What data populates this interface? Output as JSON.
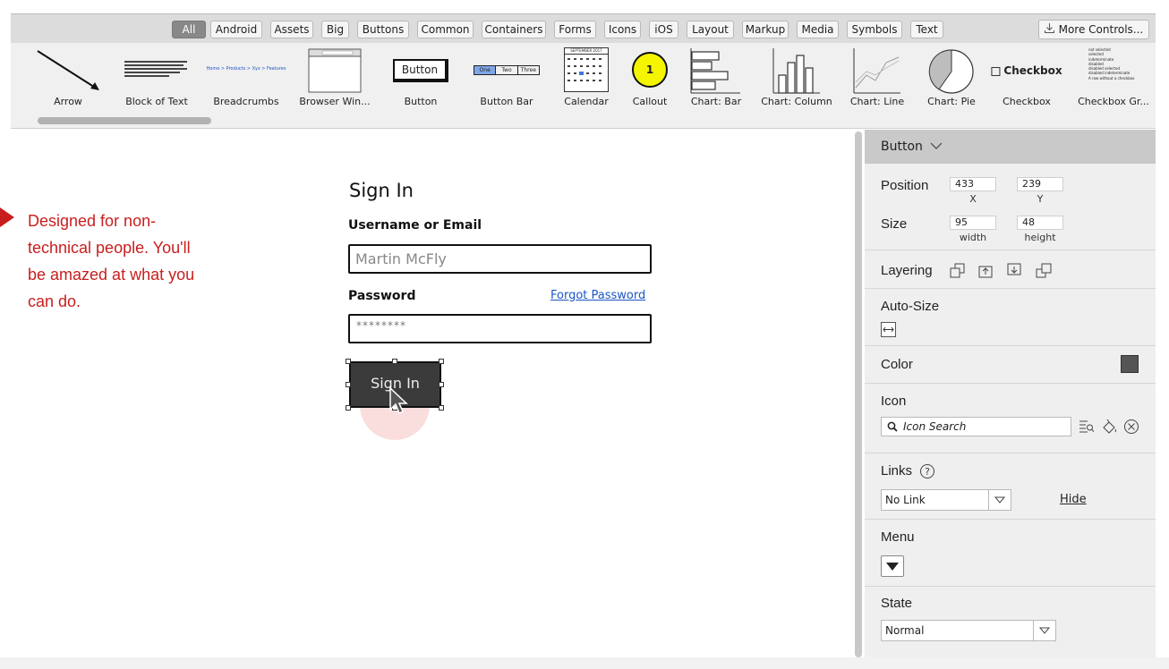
{
  "toolbar": {
    "tabs": [
      "All",
      "Android",
      "Assets",
      "Big",
      "Buttons",
      "Common",
      "Containers",
      "Forms",
      "Icons",
      "iOS",
      "Layout",
      "Markup",
      "Media",
      "Symbols",
      "Text"
    ],
    "active_tab": "All",
    "more_controls": "More Controls..."
  },
  "palette": {
    "items": [
      "Arrow",
      "Block of Text",
      "Breadcrumbs",
      "Browser Win...",
      "Button",
      "Button Bar",
      "Calendar",
      "Callout",
      "Chart: Bar",
      "Chart: Column",
      "Chart: Line",
      "Chart: Pie",
      "Checkbox",
      "Checkbox Gr..."
    ],
    "thumb_texts": {
      "breadcrumbs": "Home > Products > Xyz > Features",
      "button": "Button",
      "button_bar": [
        "One",
        "Two",
        "Three"
      ],
      "calendar_month": "SEPTEMBER 2017",
      "callout_number": "1",
      "checkbox": "Checkbox",
      "checkbox_group": [
        "not selected",
        "selected",
        "indeterminate",
        "disabled",
        "disabled selected",
        "disabled indeterminate",
        "A row without a checkbox"
      ]
    }
  },
  "canvas": {
    "callout_text": "Designed for non-technical people. You'll be amazed at what you can do.",
    "callout_color": "#c81e1e",
    "form": {
      "title": "Sign In",
      "username_label": "Username or Email",
      "username_value": "Martin McFly",
      "password_label": "Password",
      "forgot_link": "Forgot Password",
      "password_value": "********",
      "button_label": "Sign In"
    }
  },
  "props": {
    "header": "Button",
    "position": {
      "label": "Position",
      "x": "433",
      "y": "239",
      "x_label": "X",
      "y_label": "Y"
    },
    "size": {
      "label": "Size",
      "width": "95",
      "height": "48",
      "width_label": "width",
      "height_label": "height"
    },
    "layering_label": "Layering",
    "autosize_label": "Auto-Size",
    "color_label": "Color",
    "color_value": "#555555",
    "icon_label": "Icon",
    "icon_search_placeholder": "Icon Search",
    "links_label": "Links",
    "link_value": "No Link",
    "hide_link": "Hide",
    "menu_label": "Menu",
    "state_label": "State",
    "state_value": "Normal"
  }
}
